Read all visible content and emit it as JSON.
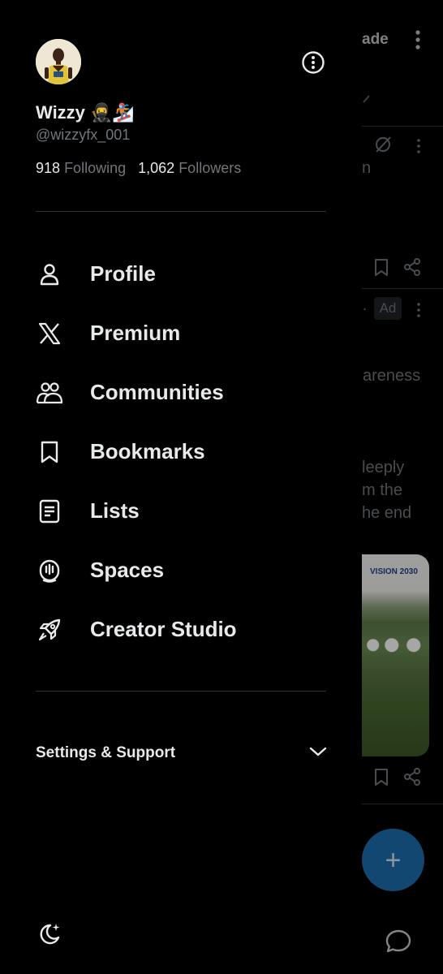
{
  "profile": {
    "display_name": "Wizzy 🥷🏂",
    "handle": "@wizzyfx_001",
    "following_count": "918",
    "following_label": "Following",
    "followers_count": "1,062",
    "followers_label": "Followers"
  },
  "menu": {
    "items": [
      {
        "label": "Profile",
        "icon": "person-icon"
      },
      {
        "label": "Premium",
        "icon": "x-logo-icon"
      },
      {
        "label": "Communities",
        "icon": "communities-icon"
      },
      {
        "label": "Bookmarks",
        "icon": "bookmark-icon"
      },
      {
        "label": "Lists",
        "icon": "list-icon"
      },
      {
        "label": "Spaces",
        "icon": "spaces-icon"
      },
      {
        "label": "Creator Studio",
        "icon": "rocket-icon"
      }
    ]
  },
  "settings": {
    "label": "Settings & Support"
  },
  "background_feed": {
    "header_fragment": "ade",
    "fragments": [
      "n",
      "areness",
      "leeply",
      "m the",
      "he end"
    ],
    "ad_badge": "Ad",
    "media_text": "VISION 2030"
  },
  "colors": {
    "background": "#000000",
    "text_primary": "#e7e9ea",
    "text_secondary": "#71767b",
    "divider": "#2f3336",
    "accent": "#1d9bf0"
  }
}
